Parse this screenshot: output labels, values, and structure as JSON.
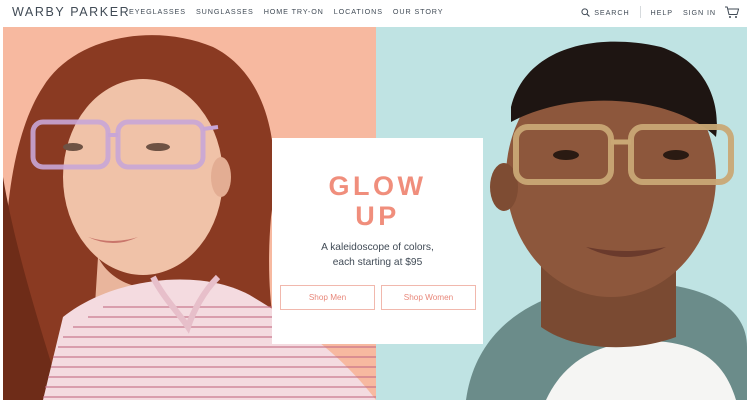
{
  "header": {
    "logo": "WARBY PARKER",
    "nav": [
      "EYEGLASSES",
      "SUNGLASSES",
      "HOME TRY-ON",
      "LOCATIONS",
      "OUR STORY"
    ],
    "search_label": "SEARCH",
    "help_label": "HELP",
    "signin_label": "SIGN IN"
  },
  "hero": {
    "headline_line1": "GLOW",
    "headline_line2": "UP",
    "tagline_line1": "A kaleidoscope of colors,",
    "tagline_line2": "each starting at $95",
    "shop_men_label": "Shop Men",
    "shop_women_label": "Shop Women"
  },
  "colors": {
    "accent": "#f08e7c",
    "text": "#414b56",
    "left_bg": "#f7b9a0",
    "right_bg": "#bfe3e3"
  },
  "icons": {
    "search": "search-icon",
    "cart": "cart-icon"
  }
}
